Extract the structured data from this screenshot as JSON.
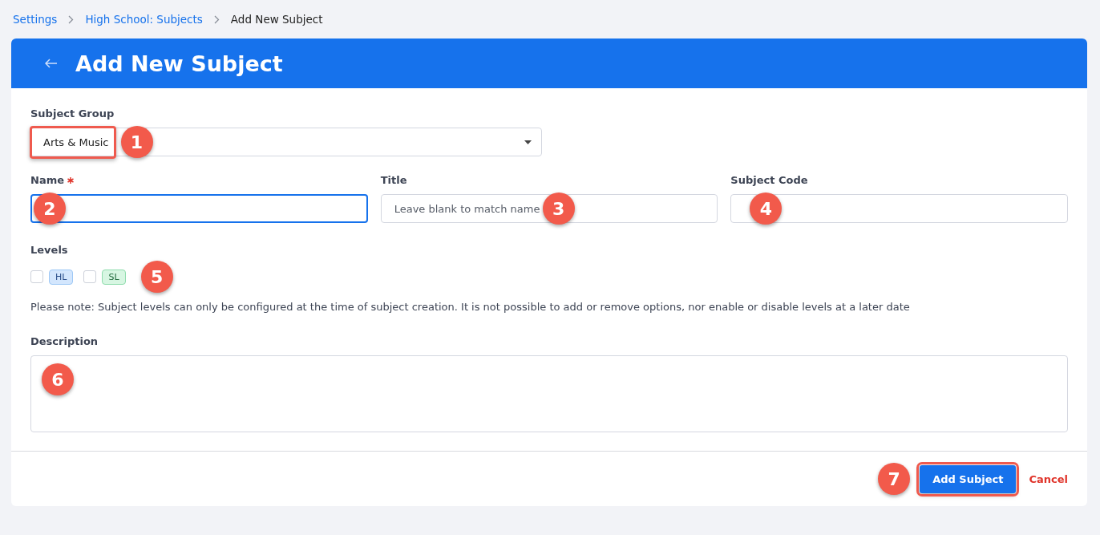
{
  "breadcrumb": [
    {
      "label": "Settings",
      "link": true
    },
    {
      "label": "High School: Subjects",
      "link": true
    },
    {
      "label": "Add New Subject",
      "link": false
    }
  ],
  "header": {
    "title": "Add New Subject"
  },
  "subject_group": {
    "label": "Subject Group",
    "value": "Arts & Music",
    "highlighted": true,
    "callout": "1"
  },
  "fields": [
    {
      "label": "Name",
      "required": true,
      "focused": true,
      "callout": "2"
    },
    {
      "label": "Title",
      "required": false,
      "focused": false,
      "placeholder": "Leave blank to match name",
      "callout": "3"
    },
    {
      "label": "Subject Code",
      "required": false,
      "focused": false,
      "callout": "4"
    }
  ],
  "levels": {
    "label": "Levels",
    "callout": "5",
    "options": [
      {
        "label": "HL",
        "checked": false,
        "color": "#d3e6fd"
      },
      {
        "label": "SL",
        "checked": false,
        "color": "#d7f6e2"
      }
    ]
  },
  "note": "Please note: Subject levels can only be configured at the time of subject creation. It is not possible to add or remove options, nor enable or disable levels at a later date",
  "description": {
    "label": "Description",
    "callout": "6"
  },
  "actions": {
    "submit": {
      "label": "Add Subject",
      "highlighted": true,
      "callout": "7"
    },
    "cancel": "Cancel"
  }
}
